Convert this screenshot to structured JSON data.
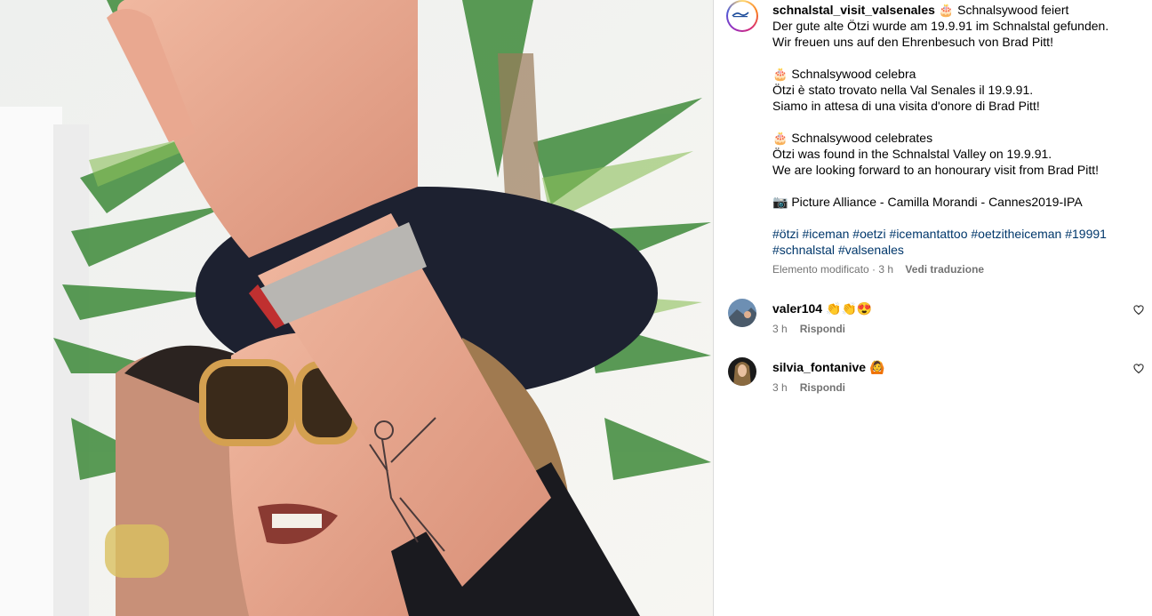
{
  "post": {
    "username": "schnalstal_visit_valsenales",
    "caption_lines": [
      "Schnalsywood feiert",
      "Der gute alte Ötzi wurde am 19.9.91 im Schnalstal gefunden.",
      "Wir freuen uns auf den Ehrenbesuch von Brad Pitt!",
      "",
      "🎂 Schnalsywood celebra",
      "Ötzi è stato trovato nella Val Senales il 19.9.91.",
      "Siamo in attesa di una visita d'onore di Brad Pitt!",
      "",
      "🎂 Schnalsywood celebrates",
      "Ötzi was found in the Schnalstal Valley on 19.9.91.",
      "We are looking forward to an honourary visit from Brad Pitt!",
      "",
      "📷 Picture Alliance - Camilla Morandi - Cannes2019-IPA",
      ""
    ],
    "cake_emoji": "🎂",
    "hashtags_line1": [
      "#ötzi",
      "#iceman",
      "#oetzi",
      "#icemantattoo",
      "#oetzitheiceman",
      "#19991"
    ],
    "hashtags_line2": [
      "#schnalstal",
      "#valsenales"
    ],
    "edited_label": "Elemento modificato · 3 h",
    "translate_label": "Vedi traduzione"
  },
  "comments": [
    {
      "username": "valer104",
      "text": "👏👏😍",
      "time": "3 h",
      "reply_label": "Rispondi"
    },
    {
      "username": "silvia_fontanive",
      "text": "🙆",
      "time": "3 h",
      "reply_label": "Rispondi"
    }
  ],
  "icons": {
    "like": "heart-outline-icon"
  },
  "colors": {
    "hashtag": "#00376b",
    "meta": "#737373"
  }
}
